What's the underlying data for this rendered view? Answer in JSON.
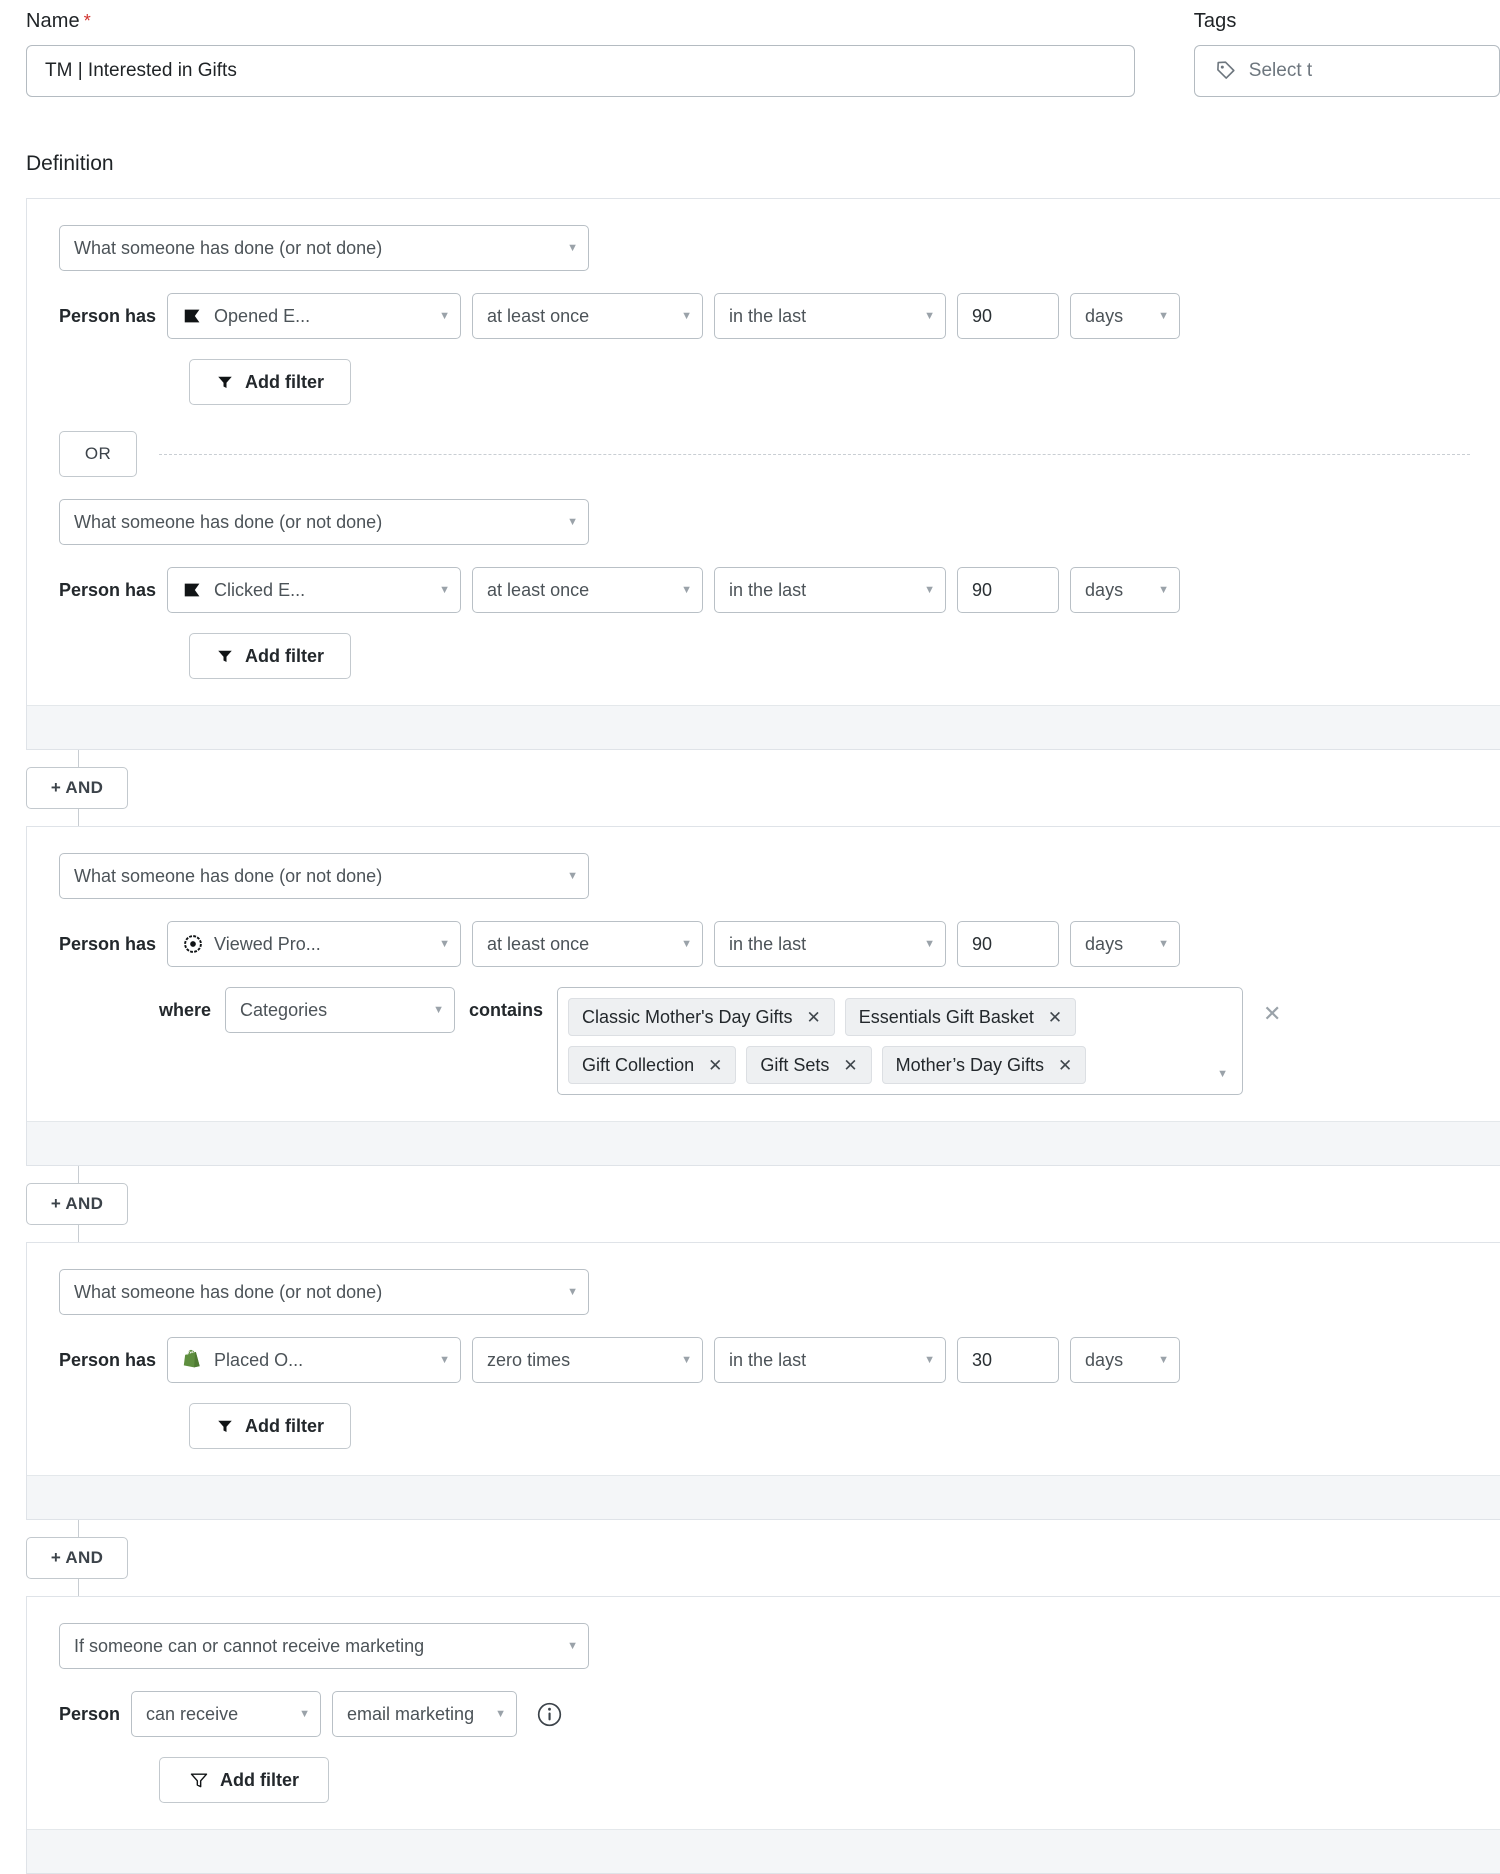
{
  "form": {
    "name_label": "Name",
    "name_required_mark": "*",
    "name_value": "TM | Interested in Gifts",
    "tags_label": "Tags",
    "tags_placeholder": "Select t"
  },
  "definition": {
    "title": "Definition",
    "and_label": "+ AND",
    "or_label": "OR",
    "add_filter_label": "Add filter",
    "person_has_label": "Person has",
    "person_label": "Person",
    "where_label": "where",
    "contains_label": "contains",
    "type_behavior": "What someone has done (or not done)",
    "type_marketing": "If someone can or cannot receive marketing"
  },
  "blocks": [
    {
      "conditions": [
        {
          "type": "What someone has done (or not done)",
          "metric": "Opened E...",
          "metric_icon": "klaviyo-flag-icon",
          "operator": "at least once",
          "timeframe": "in the last",
          "amount": "90",
          "unit": "days"
        },
        {
          "type": "What someone has done (or not done)",
          "metric": "Clicked E...",
          "metric_icon": "klaviyo-flag-icon",
          "operator": "at least once",
          "timeframe": "in the last",
          "amount": "90",
          "unit": "days"
        }
      ]
    },
    {
      "conditions": [
        {
          "type": "What someone has done (or not done)",
          "metric": "Viewed Pro...",
          "metric_icon": "target-icon",
          "operator": "at least once",
          "timeframe": "in the last",
          "amount": "90",
          "unit": "days",
          "property": "Categories",
          "property_operator": "contains",
          "chips": [
            "Classic Mother's Day Gifts",
            "Essentials Gift Basket",
            "Gift Collection",
            "Gift Sets",
            "Mother’s Day Gifts"
          ]
        }
      ]
    },
    {
      "conditions": [
        {
          "type": "What someone has done (or not done)",
          "metric": "Placed O...",
          "metric_icon": "shopify-icon",
          "operator": "zero times",
          "timeframe": "in the last",
          "amount": "30",
          "unit": "days"
        }
      ]
    },
    {
      "conditions": [
        {
          "type": "If someone can or cannot receive marketing",
          "receive": "can receive",
          "channel": "email marketing",
          "info_icon": "info-icon"
        }
      ]
    }
  ],
  "colors": {
    "border": "#b9c0c6",
    "footer_bg": "#f4f6f8",
    "chip_bg": "#eef0f2",
    "required": "#d0312d",
    "shopify_green": "#5E8E3E"
  }
}
